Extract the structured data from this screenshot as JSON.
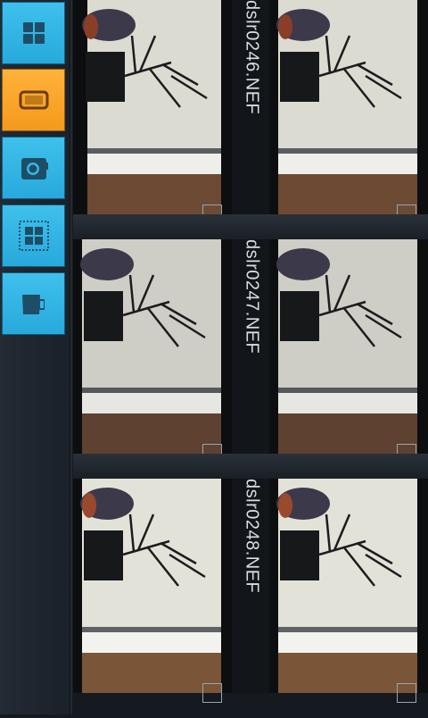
{
  "toolbar": {
    "buttons": [
      {
        "name": "grid-view-button",
        "icon": "grid-icon",
        "active": false
      },
      {
        "name": "single-view-button",
        "icon": "phone-frame-icon",
        "active": true
      },
      {
        "name": "camera-button",
        "icon": "camera-icon",
        "active": false
      },
      {
        "name": "select-all-button",
        "icon": "select-grid-icon",
        "active": false
      },
      {
        "name": "delete-button",
        "icon": "trash-icon",
        "active": false
      }
    ],
    "accent_active": "#f7a52a",
    "accent_default": "#35b6e6"
  },
  "gallery": {
    "items": [
      {
        "filename": "dslr0246.NEF"
      },
      {
        "filename": "dslr0247.NEF"
      },
      {
        "filename": "dslr0248.NEF"
      }
    ]
  }
}
